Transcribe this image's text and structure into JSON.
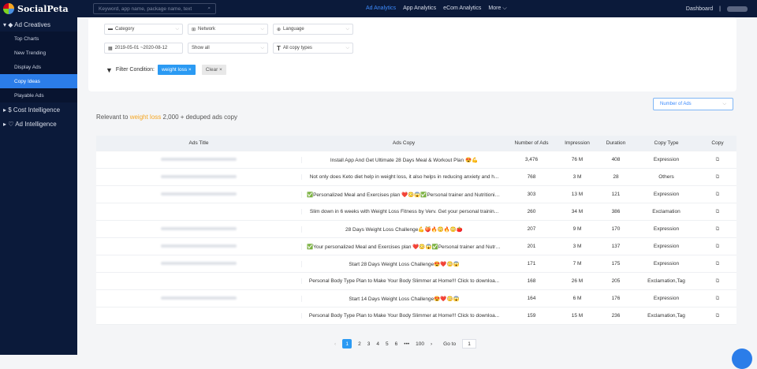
{
  "app": {
    "logo_text": "SocialPeta"
  },
  "topbar": {
    "search_placeholder": "Keyword, app name, package name, text",
    "nav": [
      "Ad Analytics",
      "App Analytics",
      "eCom Analytics",
      "More ⌵"
    ],
    "dashboard": "Dashboard",
    "divider": "|"
  },
  "sidebar": {
    "ad_creatives": "▾ ◆ Ad Creatives",
    "items": [
      "Top Charts",
      "New Trending",
      "Display Ads",
      "Copy Ideas",
      "Playable Ads"
    ],
    "cost_intelligence": "▸ $ Cost Intelligence",
    "ad_intelligence": "▸ ♡ Ad Intelligence"
  },
  "filters": {
    "category": "Category",
    "network": "Network",
    "language": "Language",
    "date_range": "2019-05-01 ~2020-08-12",
    "show_all": "Show all",
    "copy_types": "All copy types",
    "filter_condition_label": "Filter Condition:",
    "active_tag": "weight loss ×",
    "clear_tag": "Clear ×"
  },
  "sort": {
    "selected": "Number of Ads"
  },
  "summary": {
    "prefix": "Relevant to ",
    "keyword": "weight loss",
    "suffix": " 2,000 + deduped ads copy"
  },
  "table": {
    "headers": [
      "Ads Title",
      "Ads Copy",
      "Number of Ads",
      "Impression",
      "Duration",
      "Copy Type",
      "Copy"
    ],
    "rows": [
      {
        "copy": "Install App And Get Ultimate 28 Days Meal & Workout Plan 😍💪",
        "num": "3,476",
        "imp": "76 M",
        "dur": "408",
        "type": "Expression"
      },
      {
        "copy": "Not only does Keto diet help in weight loss, it also helps in reducing anxiety and h...",
        "num": "768",
        "imp": "3 M",
        "dur": "28",
        "type": "Others"
      },
      {
        "copy": "✅Personalized Meal and Exercises plan ❤️😳😱✅Personal trainer and Nutritionis...",
        "num": "303",
        "imp": "13 M",
        "dur": "121",
        "type": "Expression"
      },
      {
        "copy": "Slim down in 6 weeks with Weight Loss Fitness by Verv. Get your personal trainin...",
        "num": "260",
        "imp": "34 M",
        "dur": "386",
        "type": "Exclamation"
      },
      {
        "copy": "28 Days Weight Loss Challenge💪🍑🔥😳🔥😳🍅",
        "num": "207",
        "imp": "9 M",
        "dur": "170",
        "type": "Expression"
      },
      {
        "copy": "✅Your personalized Meal and Exercises plan ❤️😳😱✅Personal trainer and Nutrit...",
        "num": "201",
        "imp": "3 M",
        "dur": "137",
        "type": "Expression"
      },
      {
        "copy": "Start 28 Days Weight Loss Challenge😍❤️😳😱",
        "num": "171",
        "imp": "7 M",
        "dur": "175",
        "type": "Expression"
      },
      {
        "copy": "Personal Body Type Plan to Make Your Body Slimmer at Home!!! Click to downloa...",
        "num": "168",
        "imp": "26 M",
        "dur": "205",
        "type": "Exclamation,Tag"
      },
      {
        "copy": "Start 14 Days Weight Loss Challenge😍❤️😳😱",
        "num": "164",
        "imp": "6 M",
        "dur": "176",
        "type": "Expression"
      },
      {
        "copy": "Personal Body Type Plan to Make Your Body Slimmer at Home!!! Click to downloa...",
        "num": "159",
        "imp": "15 M",
        "dur": "236",
        "type": "Exclamation,Tag"
      }
    ]
  },
  "pager": {
    "prev": "‹",
    "pages": [
      "1",
      "2",
      "3",
      "4",
      "5",
      "6",
      "•••",
      "100"
    ],
    "next": "›",
    "goto_label": "Go to",
    "goto_value": "1"
  },
  "colors": {
    "sidebar_bg": "#0b1a3a",
    "accent": "#2b7de9",
    "highlight": "#f5a623"
  }
}
